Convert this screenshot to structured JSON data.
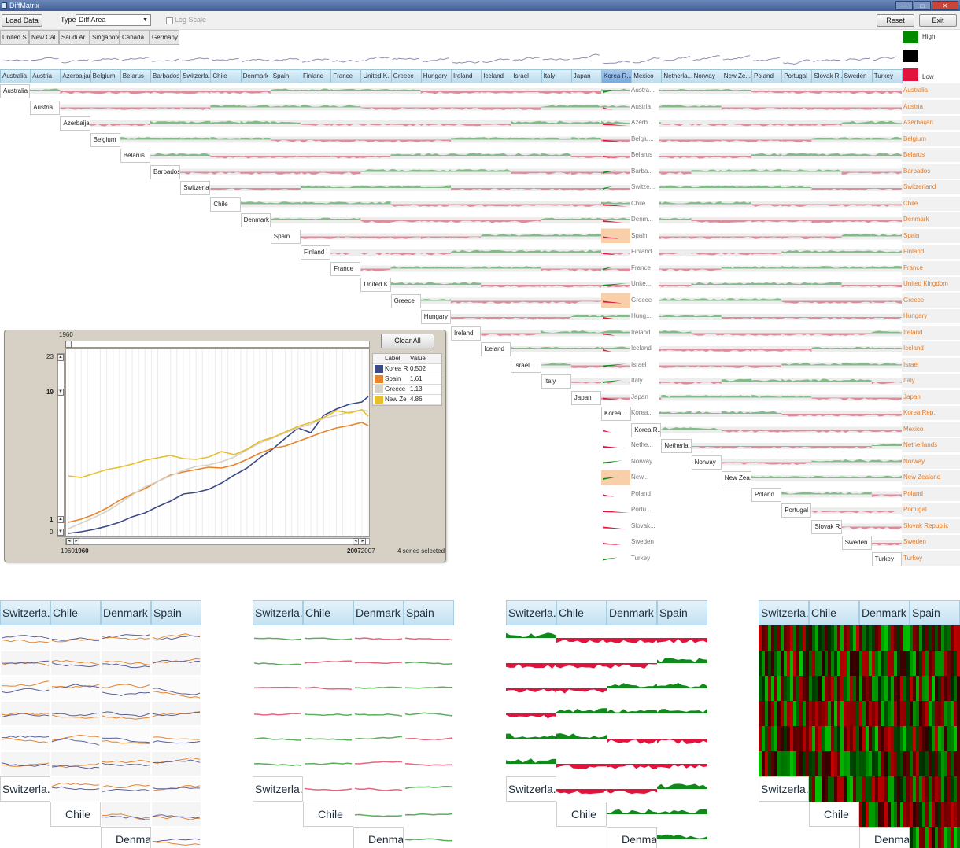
{
  "window": {
    "title": "DiffMatrix",
    "controls": [
      "—",
      "□",
      "✕"
    ]
  },
  "toolbar": {
    "load_label": "Load Data",
    "type_label": "Type",
    "type_value": "Diff Area",
    "log_scale_label": "Log Scale",
    "reset_label": "Reset",
    "exit_label": "Exit"
  },
  "chips": [
    "United S...",
    "New Cal...",
    "Saudi Ar...",
    "Singapore",
    "Canada",
    "Germany"
  ],
  "legend": {
    "high_label": "High",
    "low_label": "Low",
    "high_color": "#008a00",
    "mid_color": "#000000",
    "low_color": "#e0143c"
  },
  "columns": [
    "Australia",
    "Austria",
    "Azerbaijan",
    "Belgium",
    "Belarus",
    "Barbados",
    "Switzerla...",
    "Chile",
    "Denmark",
    "Spain",
    "Finland",
    "France",
    "United K...",
    "Greece",
    "Hungary",
    "Ireland",
    "Iceland",
    "Israel",
    "Italy",
    "Japan",
    "Korea R...",
    "Mexico",
    "Netherla...",
    "Norway",
    "New Ze...",
    "Poland",
    "Portugal",
    "Slovak R...",
    "Sweden",
    "Turkey"
  ],
  "selected_column": "Korea R...",
  "diag_labels": [
    "Australia",
    "Austria",
    "Azerbaijan",
    "Belgium",
    "Belarus",
    "Barbados",
    "Switzerla...",
    "Chile",
    "Denmark",
    "Spain",
    "Finland",
    "France",
    "United K...",
    "Greece",
    "Hungary",
    "Ireland",
    "Iceland",
    "Israel",
    "Italy",
    "Japan",
    "Korea R...",
    "Netherla...",
    "Norway",
    "New Zea...",
    "Poland",
    "Portugal",
    "Slovak R...",
    "Sweden",
    "Turkey"
  ],
  "korea_diag_label": "Korea...",
  "mid_labels": [
    "Austra...",
    "Austria",
    "Azerb...",
    "Belgiu...",
    "Belarus",
    "Barba...",
    "Switze...",
    "Chile",
    "Denm...",
    "Spain",
    "Finland",
    "France",
    "Unite...",
    "Greece",
    "Hung...",
    "Ireland",
    "Iceland",
    "Israel",
    "Italy",
    "Japan",
    "Korea...",
    "Mexico",
    "Nethe...",
    "Norway",
    "New...",
    "Poland",
    "Portu...",
    "Slovak...",
    "Sweden",
    "Turkey"
  ],
  "row_labels": [
    "Australia",
    "Austria",
    "Azerbaijan",
    "Belgium",
    "Belarus",
    "Barbados",
    "Switzerland",
    "Chile",
    "Denmark",
    "Spain",
    "Finland",
    "France",
    "United Kingdom",
    "Greece",
    "Hungary",
    "Ireland",
    "Iceland",
    "Israel",
    "Italy",
    "Japan",
    "Korea Rep.",
    "Mexico",
    "Netherlands",
    "Norway",
    "New Zealand",
    "Poland",
    "Portugal",
    "Slovak Republic",
    "Sweden",
    "Turkey"
  ],
  "popup": {
    "slider_top_value": "1960",
    "clear_all_label": "Clear All",
    "y_slider_top": "23",
    "y_slider_mid": "19",
    "y_slider_low": "1",
    "y_slider_bottom": "0",
    "x_left": "1960",
    "x_left_bold": "1960",
    "x_right_bold": "2007",
    "x_right": "2007",
    "table_header_label": "Label",
    "table_header_value": "Value",
    "status": "4 series selected"
  },
  "chart_data": {
    "type": "line",
    "x": [
      1960,
      1962,
      1964,
      1966,
      1968,
      1970,
      1972,
      1974,
      1976,
      1978,
      1980,
      1982,
      1984,
      1986,
      1988,
      1990,
      1992,
      1994,
      1996,
      1998,
      2000,
      2002,
      2004,
      2006,
      2007
    ],
    "ylim": [
      0,
      23
    ],
    "series": [
      {
        "name": "Korea R",
        "value_label": "0.502",
        "color": "#3b4a86",
        "values": [
          0.2,
          0.4,
          0.7,
          1.1,
          1.6,
          2.3,
          2.8,
          3.6,
          4.3,
          5.2,
          5.4,
          5.8,
          6.6,
          7.6,
          8.5,
          9.8,
          10.9,
          12.3,
          13.6,
          13.0,
          15.2,
          16.0,
          16.6,
          16.9,
          17.6
        ]
      },
      {
        "name": "Spain",
        "value_label": "1.61",
        "color": "#e8832a",
        "values": [
          1.6,
          2.0,
          2.6,
          3.4,
          4.4,
          5.2,
          5.9,
          6.8,
          7.6,
          8.0,
          8.3,
          8.6,
          8.5,
          8.9,
          9.6,
          10.4,
          11.0,
          11.3,
          11.9,
          12.5,
          13.1,
          13.6,
          13.9,
          14.3,
          13.9
        ]
      },
      {
        "name": "Greece",
        "value_label": "1.13",
        "color": "#d7d2c6",
        "values": [
          0.8,
          1.5,
          2.2,
          3.0,
          4.0,
          5.1,
          6.1,
          6.8,
          7.5,
          8.2,
          8.7,
          8.9,
          9.3,
          9.9,
          10.8,
          11.7,
          12.3,
          13.0,
          13.6,
          14.1,
          14.8,
          15.2,
          15.6,
          15.9,
          15.7
        ]
      },
      {
        "name": "New Ze",
        "value_label": "4.86",
        "color": "#e6bf2a",
        "values": [
          7.5,
          7.3,
          7.8,
          8.3,
          8.6,
          9.0,
          9.5,
          9.8,
          10.1,
          9.7,
          9.6,
          9.9,
          10.6,
          10.2,
          10.9,
          11.9,
          12.4,
          13.1,
          13.8,
          14.3,
          14.9,
          15.8,
          15.5,
          15.9,
          15.1
        ]
      }
    ]
  },
  "panels": {
    "headers": [
      "Switzerla...",
      "Chile",
      "Denmark",
      "Spain"
    ],
    "diag_labels": [
      "Switzerla...",
      "Chile",
      "Denmark"
    ]
  }
}
